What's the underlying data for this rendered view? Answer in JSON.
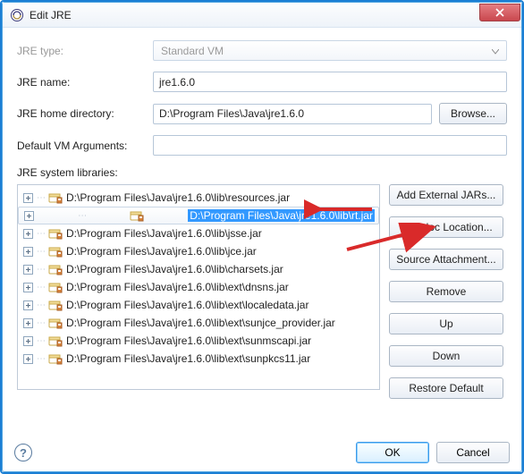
{
  "title": "Edit JRE",
  "labels": {
    "jre_type": "JRE type:",
    "jre_name": "JRE name:",
    "jre_home": "JRE home directory:",
    "default_args": "Default VM Arguments:",
    "sys_libs": "JRE system libraries:"
  },
  "values": {
    "jre_type": "Standard VM",
    "jre_name": "jre1.6.0",
    "jre_home": "D:\\Program Files\\Java\\jre1.6.0",
    "default_args": ""
  },
  "buttons": {
    "browse": "Browse...",
    "add_ext": "Add External JARs...",
    "javadoc": "Javadoc Location...",
    "source": "Source Attachment...",
    "remove": "Remove",
    "up": "Up",
    "down": "Down",
    "restore": "Restore Default",
    "ok": "OK",
    "cancel": "Cancel"
  },
  "tree": [
    "D:\\Program Files\\Java\\jre1.6.0\\lib\\resources.jar",
    "D:\\Program Files\\Java\\jre1.6.0\\lib\\rt.jar",
    "D:\\Program Files\\Java\\jre1.6.0\\lib\\jsse.jar",
    "D:\\Program Files\\Java\\jre1.6.0\\lib\\jce.jar",
    "D:\\Program Files\\Java\\jre1.6.0\\lib\\charsets.jar",
    "D:\\Program Files\\Java\\jre1.6.0\\lib\\ext\\dnsns.jar",
    "D:\\Program Files\\Java\\jre1.6.0\\lib\\ext\\localedata.jar",
    "D:\\Program Files\\Java\\jre1.6.0\\lib\\ext\\sunjce_provider.jar",
    "D:\\Program Files\\Java\\jre1.6.0\\lib\\ext\\sunmscapi.jar",
    "D:\\Program Files\\Java\\jre1.6.0\\lib\\ext\\sunpkcs11.jar"
  ],
  "selected_index": 1
}
